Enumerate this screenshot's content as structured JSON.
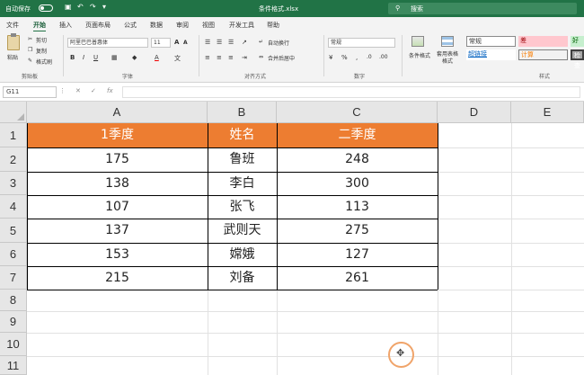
{
  "titlebar": {
    "autosave_label": "自动保存",
    "autosave_state": "关",
    "doc_title": "条件格式.xlsx",
    "search_placeholder": "搜索"
  },
  "ribbon_tabs": [
    "文件",
    "开始",
    "插入",
    "页面布局",
    "公式",
    "数据",
    "审阅",
    "视图",
    "开发工具",
    "帮助"
  ],
  "active_tab": "开始",
  "ribbon": {
    "clipboard": {
      "paste": "粘贴",
      "cut": "剪切",
      "copy": "复制",
      "format_painter": "格式刷",
      "label": "剪贴板"
    },
    "font": {
      "name": "阿里巴巴普惠体",
      "size": "11",
      "label": "字体"
    },
    "alignment": {
      "wrap": "自动换行",
      "merge": "合并后居中",
      "label": "对齐方式"
    },
    "number": {
      "format": "常规",
      "label": "数字"
    },
    "styles": {
      "conditional": "条件格式",
      "table": "套用表格格式",
      "normal": "常规",
      "bad": "差",
      "good": "好",
      "link": "超链接",
      "calc": "计算",
      "check": "检查",
      "label": "样式"
    }
  },
  "formula_bar": {
    "name_box": "G11",
    "fx": "fx",
    "content": ""
  },
  "columns": [
    "A",
    "B",
    "C",
    "D",
    "E"
  ],
  "rows": [
    "1",
    "2",
    "3",
    "4",
    "5",
    "6",
    "7",
    "8",
    "9",
    "10",
    "11"
  ],
  "table": {
    "headers": [
      "1季度",
      "姓名",
      "二季度"
    ],
    "rows": [
      [
        "175",
        "鲁班",
        "248"
      ],
      [
        "138",
        "李白",
        "300"
      ],
      [
        "107",
        "张飞",
        "113"
      ],
      [
        "137",
        "武则天",
        "275"
      ],
      [
        "153",
        "嫦娥",
        "127"
      ],
      [
        "215",
        "刘备",
        "261"
      ]
    ]
  },
  "colors": {
    "excel_green": "#217346",
    "header_fill": "#ed7d31"
  }
}
